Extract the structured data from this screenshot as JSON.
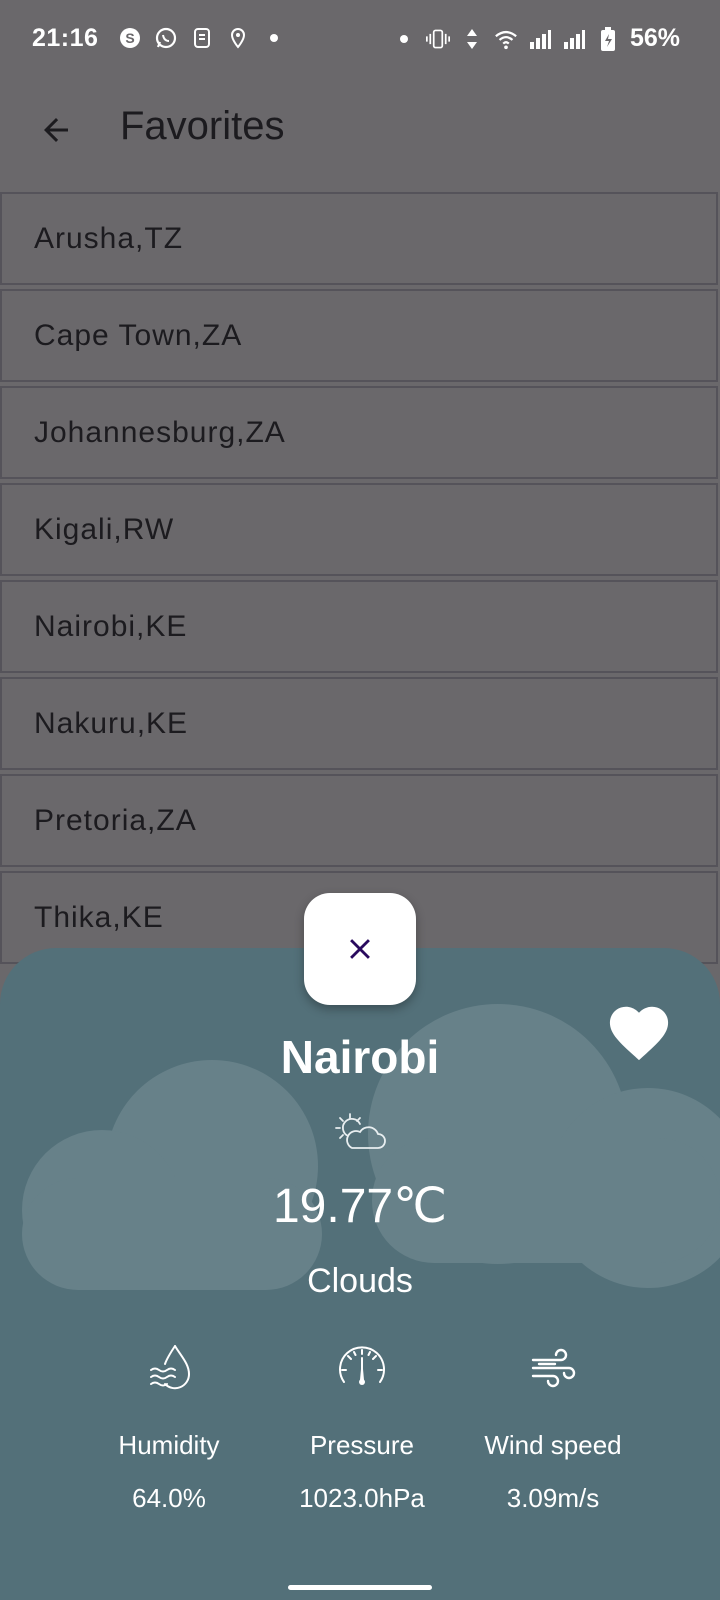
{
  "status_bar": {
    "time": "21:16",
    "battery": "56%",
    "left_icons": [
      "skype-icon",
      "whatsapp-icon",
      "app-icon",
      "location-icon",
      "dot-icon"
    ],
    "right_icons": [
      "dot-icon",
      "vibrate-icon",
      "data-arrows-icon",
      "wifi-icon",
      "signal-icon",
      "signal-r-icon",
      "battery-icon"
    ]
  },
  "header": {
    "title": "Favorites",
    "back_icon": "arrow-back-icon"
  },
  "favorites": [
    {
      "label": "Arusha,TZ"
    },
    {
      "label": "Cape Town,ZA"
    },
    {
      "label": "Johannesburg,ZA"
    },
    {
      "label": "Kigali,RW"
    },
    {
      "label": "Nairobi,KE"
    },
    {
      "label": "Nakuru,KE"
    },
    {
      "label": "Pretoria,ZA"
    },
    {
      "label": "Thika,KE"
    }
  ],
  "sheet": {
    "city": "Nairobi",
    "temperature": "19.77℃",
    "condition": "Clouds",
    "stats": {
      "humidity": {
        "label": "Humidity",
        "value": "64.0%"
      },
      "pressure": {
        "label": "Pressure",
        "value": "1023.0hPa"
      },
      "wind": {
        "label": "Wind speed",
        "value": "3.09m/s"
      }
    }
  },
  "colors": {
    "scrim_background": "#6a686b",
    "sheet_background": "#537079",
    "cloud": "#678189",
    "close_icon": "#2a0a5e"
  }
}
